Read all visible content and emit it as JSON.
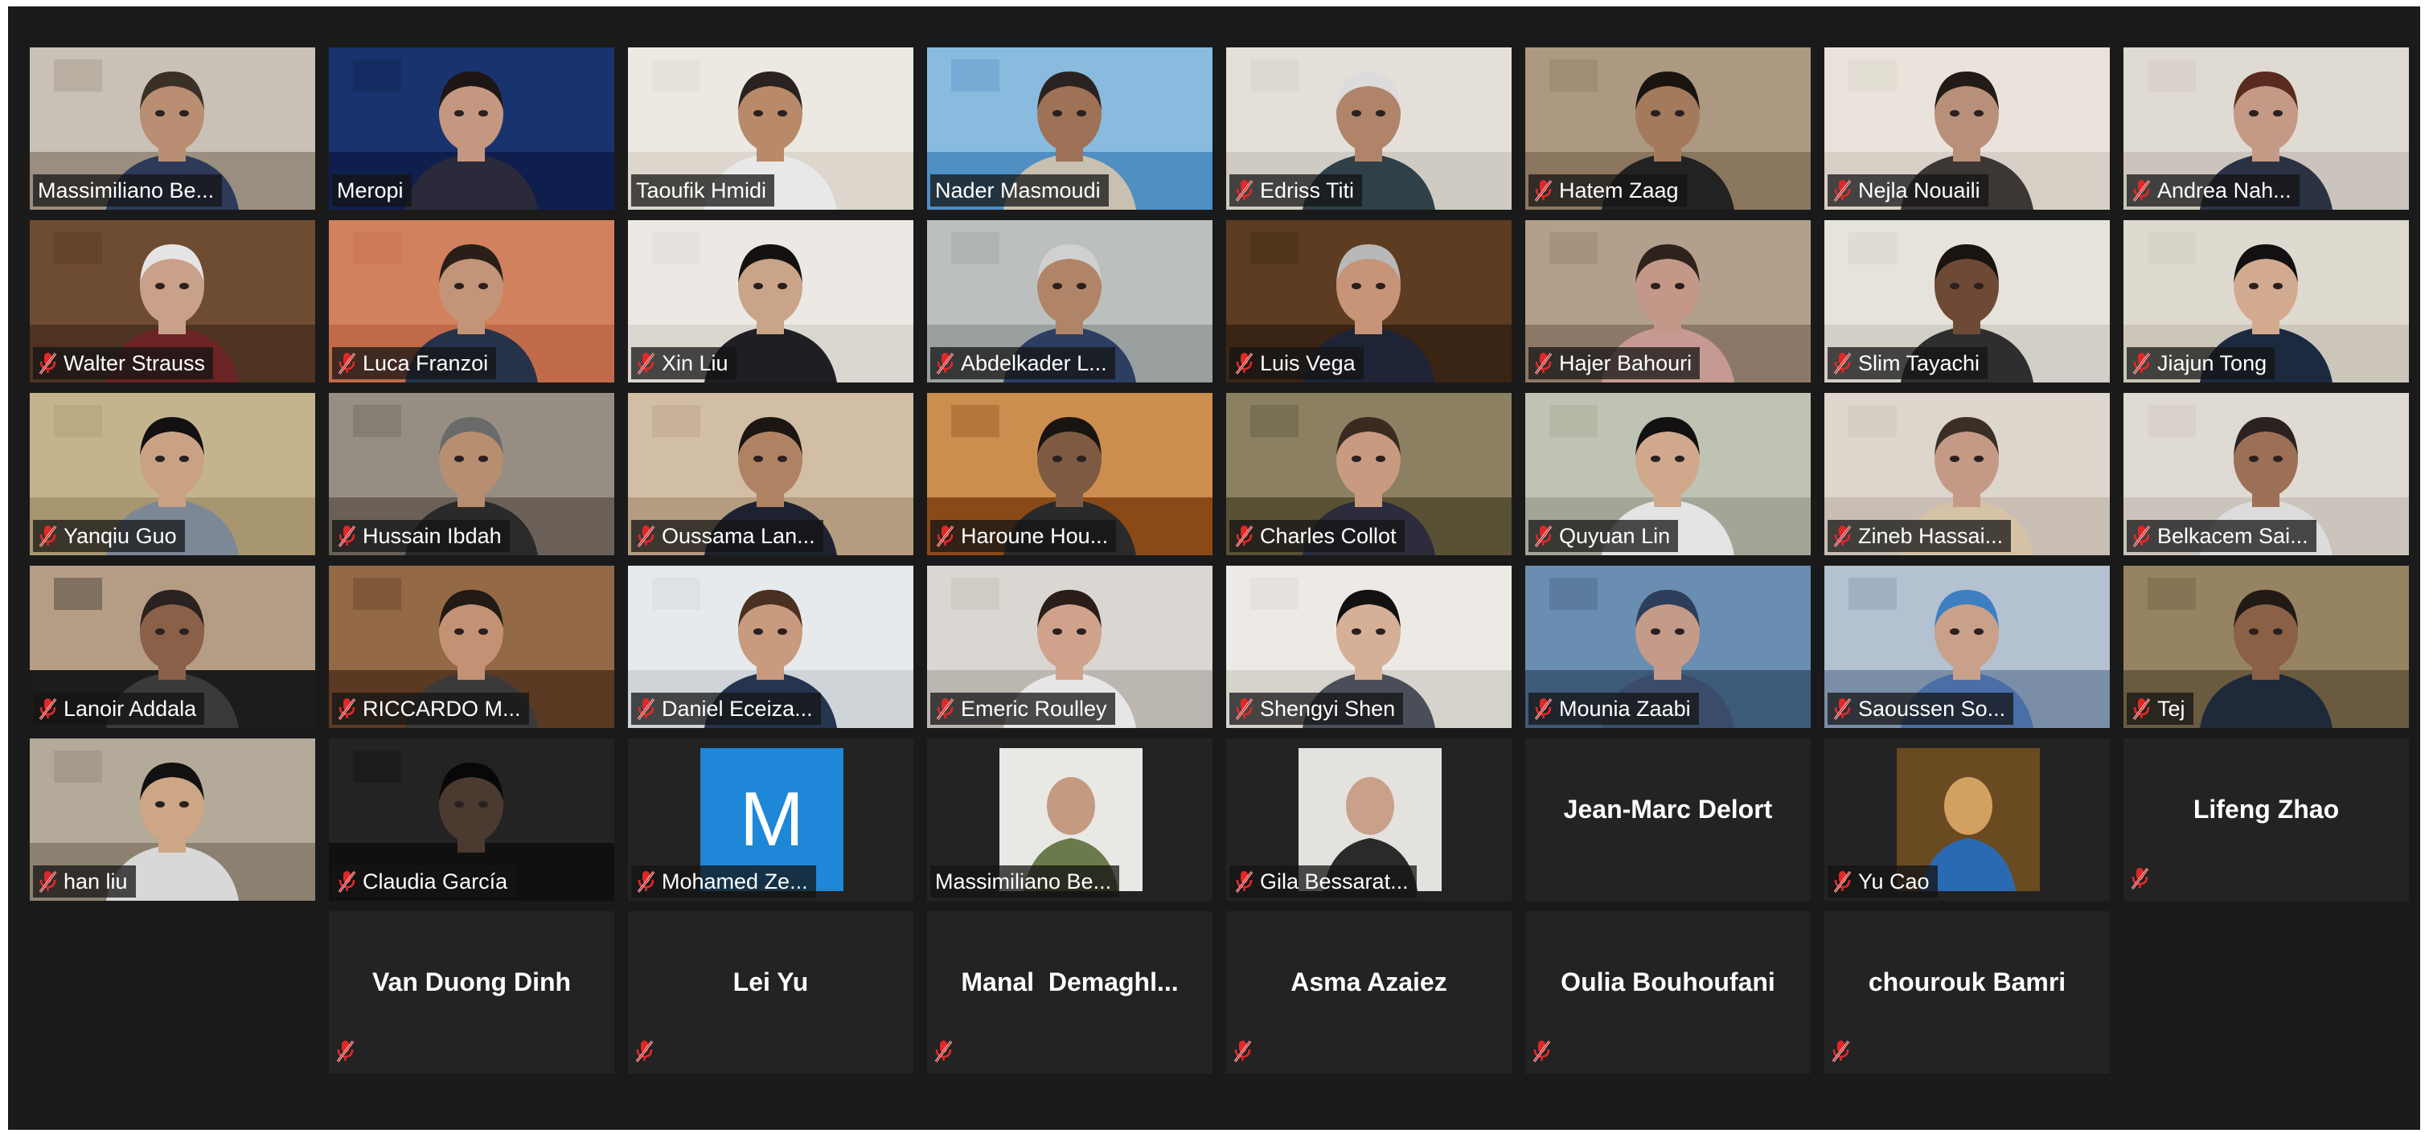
{
  "participants": [
    {
      "name": "Massimiliano Be...",
      "muted": false,
      "active": false,
      "bg": "#9a8e80",
      "wall": "#d8d2c8",
      "skin": "#b98e72",
      "shirt": "#2d3a5a",
      "hair": "#3a3028"
    },
    {
      "name": "Meropi",
      "muted": false,
      "active": true,
      "bg": "#0f1f4d",
      "wall": "#1d3b7a",
      "skin": "#c49780",
      "shirt": "#2a2a3a",
      "hair": "#1e1614"
    },
    {
      "name": "Taoufik Hmidi",
      "muted": false,
      "active": false,
      "bg": "#dcd6cc",
      "wall": "#f2efe9",
      "skin": "#b88a6a",
      "shirt": "#e8e8e8",
      "hair": "#2a2220"
    },
    {
      "name": "Nader Masmoudi",
      "muted": false,
      "active": false,
      "bg": "#4f8fc2",
      "wall": "#9cc9e8",
      "skin": "#9e7256",
      "shirt": "#c8c0b0",
      "hair": "#2a2220"
    },
    {
      "name": "Edriss Titi",
      "muted": true,
      "active": false,
      "bg": "#cfcac2",
      "wall": "#ebe7e0",
      "skin": "#b08468",
      "shirt": "#2f4048",
      "hair": "#dcdcdc"
    },
    {
      "name": "Hatem Zaag",
      "muted": true,
      "active": false,
      "bg": "#8b7660",
      "wall": "#b8a48c",
      "skin": "#a37a5c",
      "shirt": "#222222",
      "hair": "#1a1410"
    },
    {
      "name": "Nejla Nouaili",
      "muted": true,
      "active": false,
      "bg": "#d8d0c6",
      "wall": "#efe9e2",
      "skin": "#b8907a",
      "shirt": "#3c3634",
      "hair": "#221a16"
    },
    {
      "name": "Andrea Nah...",
      "muted": true,
      "active": false,
      "bg": "#cac4bc",
      "wall": "#e6e1da",
      "skin": "#c49a86",
      "shirt": "#2a3244",
      "hair": "#5a2a1e"
    },
    {
      "name": "Walter Strauss",
      "muted": true,
      "active": false,
      "bg": "#4e3322",
      "wall": "#7a5638",
      "skin": "#c9a08a",
      "shirt": "#6b2424",
      "hair": "#e4e4e4"
    },
    {
      "name": "Luca Franzoi",
      "muted": true,
      "active": false,
      "bg": "#c06a4a",
      "wall": "#d88a66",
      "skin": "#c29478",
      "shirt": "#26324a",
      "hair": "#2a1e18"
    },
    {
      "name": "Xin Liu",
      "muted": true,
      "active": false,
      "bg": "#dad6d0",
      "wall": "#f1eeea",
      "skin": "#c9a488",
      "shirt": "#1e1e24",
      "hair": "#141010"
    },
    {
      "name": "Abdelkader L...",
      "muted": true,
      "active": false,
      "bg": "#9aa0a0",
      "wall": "#c6cbc8",
      "skin": "#b08466",
      "shirt": "#2c3e62",
      "hair": "#d0d0d0"
    },
    {
      "name": "Luis Vega",
      "muted": true,
      "active": false,
      "bg": "#3a2414",
      "wall": "#6a4426",
      "skin": "#c79478",
      "shirt": "#1e2436",
      "hair": "#b8b8b8"
    },
    {
      "name": "Hajer Bahouri",
      "muted": true,
      "active": false,
      "bg": "#8c7866",
      "wall": "#c0ad9a",
      "skin": "#c39888",
      "shirt": "#c69a92",
      "hair": "#2e221c"
    },
    {
      "name": "Slim Tayachi",
      "muted": true,
      "active": false,
      "bg": "#d2cec8",
      "wall": "#ece9e4",
      "skin": "#6e4a36",
      "shirt": "#2e2e2e",
      "hair": "#1a1410"
    },
    {
      "name": "Jiajun Tong",
      "muted": true,
      "active": false,
      "bg": "#ccc6ba",
      "wall": "#e6e0d6",
      "skin": "#d2aa90",
      "shirt": "#1c2a40",
      "hair": "#121010"
    },
    {
      "name": "Yanqiu Guo",
      "muted": true,
      "active": false,
      "bg": "#a89670",
      "wall": "#cdbd98",
      "skin": "#c9a283",
      "shirt": "#7c8896",
      "hair": "#121010"
    },
    {
      "name": "Hussain Ibdah",
      "muted": true,
      "active": false,
      "bg": "#6a6058",
      "wall": "#a69c92",
      "skin": "#b88e70",
      "shirt": "#2a2a2a",
      "hair": "#6a6a6a"
    },
    {
      "name": "Oussama Lan...",
      "muted": true,
      "active": false,
      "bg": "#b49c80",
      "wall": "#dccab2",
      "skin": "#b08264",
      "shirt": "#1e2230",
      "hair": "#1c1612"
    },
    {
      "name": "Haroune Hou...",
      "muted": true,
      "active": false,
      "bg": "#8a4a18",
      "wall": "#e2a662",
      "skin": "#7e5a42",
      "shirt": "#2a2a2a",
      "hair": "#1a1410"
    },
    {
      "name": "Charles Collot",
      "muted": true,
      "active": false,
      "bg": "#5a5036",
      "wall": "#9c9070",
      "skin": "#c89a80",
      "shirt": "#2c2c3c",
      "hair": "#3a2a20"
    },
    {
      "name": "Quyuan Lin",
      "muted": true,
      "active": false,
      "bg": "#a2a696",
      "wall": "#c8ccbc",
      "skin": "#d0a88c",
      "shirt": "#e4e4e4",
      "hair": "#121010"
    },
    {
      "name": "Zineb Hassai...",
      "muted": true,
      "active": false,
      "bg": "#c8beb4",
      "wall": "#e4ddd4",
      "skin": "#c49a86",
      "shirt": "#d6c2a6",
      "hair": "#3a2e26"
    },
    {
      "name": "Belkacem Sai...",
      "muted": true,
      "active": false,
      "bg": "#cac4bc",
      "wall": "#e6e1da",
      "skin": "#9c7056",
      "shirt": "#dcdcdc",
      "hair": "#2a2220"
    },
    {
      "name": "Lanoir Addala",
      "muted": true,
      "active": false,
      "bg": "#1c1c1c",
      "wall": "#e8c8a8",
      "skin": "#8a6048",
      "shirt": "#3a3a3a",
      "hair": "#2a2220"
    },
    {
      "name": "RICCARDO M...",
      "muted": true,
      "active": false,
      "bg": "#5a3a22",
      "wall": "#a87a52",
      "skin": "#c39274",
      "shirt": "#3a3a3a",
      "hair": "#221a14"
    },
    {
      "name": "Daniel Eceiza...",
      "muted": true,
      "active": false,
      "bg": "#cfd4d8",
      "wall": "#eef1f3",
      "skin": "#c89a7e",
      "shirt": "#253550",
      "hair": "#4a3020"
    },
    {
      "name": "Emeric Roulley",
      "muted": true,
      "active": false,
      "bg": "#bcb6b0",
      "wall": "#e4e0dc",
      "skin": "#d0a28c",
      "shirt": "#e6e6e6",
      "hair": "#2a1e18"
    },
    {
      "name": "Shengyi Shen",
      "muted": true,
      "active": false,
      "bg": "#d6d2cc",
      "wall": "#f4f2ef",
      "skin": "#d6b096",
      "shirt": "#4a4e58",
      "hair": "#121010"
    },
    {
      "name": "Mounia Zaabi",
      "muted": true,
      "active": false,
      "bg": "#3e5a7a",
      "wall": "#7aa0c6",
      "skin": "#c49a88",
      "shirt": "#3a4c6a",
      "hair": "#2c3e5a"
    },
    {
      "name": "Saoussen So...",
      "muted": true,
      "active": false,
      "bg": "#7a8ea8",
      "wall": "#c8d2de",
      "skin": "#c9a08a",
      "shirt": "#4a6ea6",
      "hair": "#3e7fc2"
    },
    {
      "name": "Tej",
      "muted": true,
      "active": false,
      "bg": "#6a5a40",
      "wall": "#a4926c",
      "skin": "#8a6046",
      "shirt": "#1e2a3a",
      "hair": "#221a14"
    }
  ],
  "row5": [
    {
      "kind": "video",
      "name": "han liu",
      "muted": true,
      "bg": "#8c8070",
      "wall": "#c2b8a8",
      "skin": "#cda686",
      "shirt": "#d8d8d8",
      "hair": "#121010"
    },
    {
      "kind": "video",
      "name": "Claudia García",
      "muted": true,
      "bg": "#101010",
      "wall": "#2a2a2a",
      "skin": "#4a3a30",
      "shirt": "#101010",
      "hair": "#080808"
    },
    {
      "kind": "avatar",
      "name": "Mohamed Ze...",
      "muted": true,
      "letter": "M",
      "color": "#1e87d8"
    },
    {
      "kind": "photo",
      "name": "Massimiliano Be...",
      "muted": false,
      "bg": "#e8e8e4",
      "skin": "#c49a80",
      "shirt": "#6a7a4a"
    },
    {
      "kind": "photo",
      "name": "Gila Bessarat...",
      "muted": true,
      "bg": "#e4e2de",
      "skin": "#c9a08a",
      "shirt": "#2a2a2a"
    },
    {
      "kind": "name",
      "name": "Jean-Marc Delort",
      "muted": false
    },
    {
      "kind": "photo",
      "name": "Yu Cao",
      "muted": true,
      "bg": "#6a4a20",
      "skin": "#d2a060",
      "shirt": "#2a6ab2"
    },
    {
      "kind": "name",
      "name": "Lifeng Zhao",
      "muted": true
    }
  ],
  "row6": [
    {
      "name": "Van Duong Dinh",
      "muted": true
    },
    {
      "name": "Lei Yu",
      "muted": true
    },
    {
      "name": "Manal  Demaghl...",
      "muted": true
    },
    {
      "name": "Asma Azaiez",
      "muted": true
    },
    {
      "name": "Oulia Bouhoufani",
      "muted": true
    },
    {
      "name": "chourouk Bamri",
      "muted": true
    }
  ],
  "icons": {
    "muted_mic": "muted-mic-icon"
  },
  "colors": {
    "active_border": "#c7d35a",
    "mute_red": "#e02828",
    "tile_bg": "#232323",
    "app_bg": "#1a1a1a"
  }
}
